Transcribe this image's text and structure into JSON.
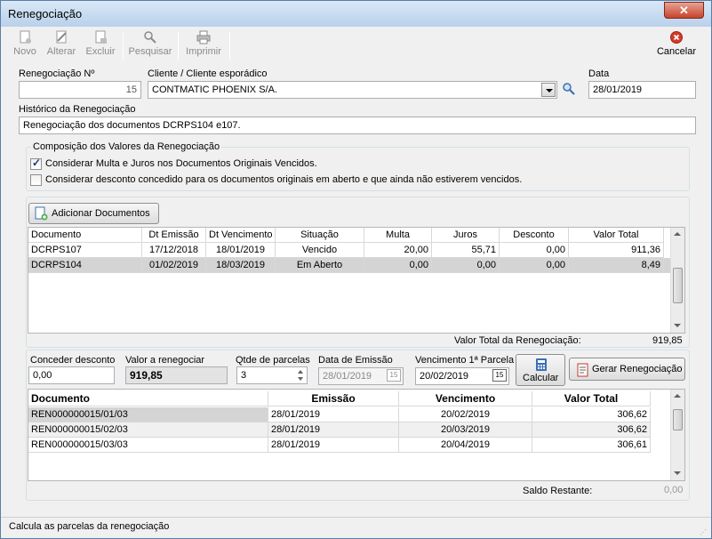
{
  "window": {
    "title": "Renegociação"
  },
  "toolbar": {
    "novo": "Novo",
    "alterar": "Alterar",
    "excluir": "Excluir",
    "pesquisar": "Pesquisar",
    "imprimir": "Imprimir",
    "cancelar": "Cancelar"
  },
  "form": {
    "renegociacao_label": "Renegociação Nº",
    "renegociacao_value": "15",
    "cliente_label": "Cliente / Cliente esporádico",
    "cliente_value": "CONTMATIC PHOENIX S/A.",
    "data_label": "Data",
    "data_value": "28/01/2019",
    "historico_label": "Histórico da Renegociação",
    "historico_value": "Renegociação dos documentos DCRPS104 e107."
  },
  "composicao": {
    "title": "Composição dos Valores da Renegociação",
    "check1_label": "Considerar Multa e Juros nos Documentos Originais Vencidos.",
    "check1_checked": true,
    "check2_label": "Considerar desconto concedido para os documentos originais em aberto e que ainda não estiverem vencidos.",
    "check2_checked": false
  },
  "adicionar_button": "Adicionar Documentos",
  "docs_table": {
    "headers": [
      "Documento",
      "Dt Emissão",
      "Dt Vencimento",
      "Situação",
      "Multa",
      "Juros",
      "Desconto",
      "Valor Total"
    ],
    "rows": [
      [
        "DCRPS107",
        "17/12/2018",
        "18/01/2019",
        "Vencido",
        "20,00",
        "55,71",
        "0,00",
        "911,36"
      ],
      [
        "DCRPS104",
        "01/02/2019",
        "18/03/2019",
        "Em Aberto",
        "0,00",
        "0,00",
        "0,00",
        "8,49"
      ]
    ]
  },
  "valor_total": {
    "label": "Valor Total da Renegociação:",
    "value": "919,85"
  },
  "parcelamento": {
    "desconto_label": "Conceder desconto",
    "desconto_value": "0,00",
    "valor_label": "Valor a renegociar",
    "valor_value": "919,85",
    "qtde_label": "Qtde de parcelas",
    "qtde_value": "3",
    "emissao_label": "Data de Emissão",
    "emissao_value": "28/01/2019",
    "venc_label": "Vencimento 1ª Parcela",
    "venc_value": "20/02/2019",
    "calcular": "Calcular",
    "gerar": "Gerar Renegociação",
    "cal_glyph": "15"
  },
  "parcelas_table": {
    "headers": [
      "Documento",
      "Emissão",
      "Vencimento",
      "Valor Total"
    ],
    "rows": [
      [
        "REN000000015/01/03",
        "28/01/2019",
        "20/02/2019",
        "306,62"
      ],
      [
        "REN000000015/02/03",
        "28/01/2019",
        "20/03/2019",
        "306,62"
      ],
      [
        "REN000000015/03/03",
        "28/01/2019",
        "20/04/2019",
        "306,61"
      ]
    ]
  },
  "saldo": {
    "label": "Saldo Restante:",
    "value": "0,00"
  },
  "status": {
    "text": "Calcula as parcelas da renegociação"
  },
  "colors": {
    "selected_row": "#d4d4d4",
    "accent": "#3c6fb4",
    "cancel_red": "#d13b2a"
  }
}
